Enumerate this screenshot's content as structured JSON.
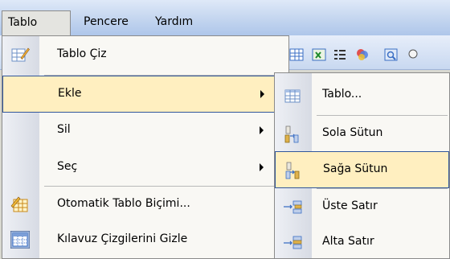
{
  "menubar": {
    "items": [
      {
        "label": "Tablo",
        "open": true
      },
      {
        "label": "Pencere"
      },
      {
        "label": "Yardım"
      }
    ]
  },
  "toolbar": {
    "icons": [
      "table-grid-icon",
      "excel-table-icon",
      "list-columns-icon",
      "merge-colors-icon",
      "properties-icon"
    ]
  },
  "tablo_menu": {
    "items": [
      {
        "label": "Tablo Çiz",
        "icon": "pencil-table-icon",
        "has_submenu": false
      },
      {
        "label": "Ekle",
        "icon": null,
        "has_submenu": true,
        "highlighted": true
      },
      {
        "label": "Sil",
        "icon": null,
        "has_submenu": true
      },
      {
        "label": "Seç",
        "icon": null,
        "has_submenu": true
      },
      {
        "label": "Otomatik Tablo Biçimi...",
        "icon": "autoformat-table-icon",
        "has_submenu": false
      },
      {
        "label": "Kılavuz Çizgilerini Gizle",
        "icon": "gridlines-icon",
        "has_submenu": false
      }
    ]
  },
  "ekle_submenu": {
    "items": [
      {
        "label": "Tablo...",
        "icon": "insert-table-icon"
      },
      {
        "label": "Sola Sütun",
        "icon": "insert-column-left-icon"
      },
      {
        "label": "Sağa Sütun",
        "icon": "insert-column-right-icon",
        "highlighted": true
      },
      {
        "label": "Üste Satır",
        "icon": "insert-row-above-icon"
      },
      {
        "label": "Alta Satır",
        "icon": "insert-row-below-icon"
      }
    ]
  },
  "colors": {
    "highlight_bg": "#ffefc0",
    "highlight_border": "#31569a",
    "menu_bg": "#f9f8f4",
    "menubar_bg": "#c3d5ef"
  }
}
